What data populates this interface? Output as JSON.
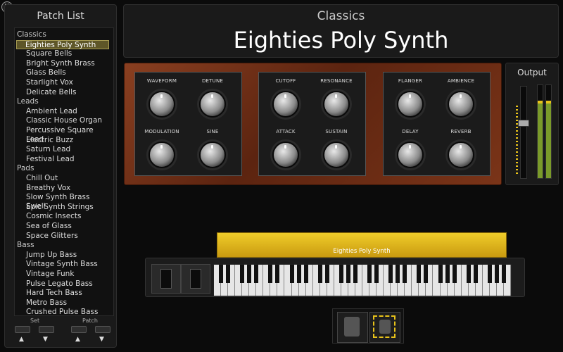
{
  "patch_list": {
    "title": "Patch List",
    "categories": [
      {
        "name": "Classics",
        "items": [
          "Eighties Poly Synth",
          "Square Bells",
          "Bright Synth Brass",
          "Glass Bells",
          "Starlight Vox",
          "Delicate Bells"
        ]
      },
      {
        "name": "Leads",
        "items": [
          "Ambient Lead",
          "Classic House Organ",
          "Percussive Square Lead",
          "Electric Buzz",
          "Saturn Lead",
          "Festival Lead"
        ]
      },
      {
        "name": "Pads",
        "items": [
          "Chill Out",
          "Breathy Vox",
          "Slow Synth Brass Swell",
          "Epic Synth Strings",
          "Cosmic Insects",
          "Sea of Glass",
          "Space Glitters"
        ]
      },
      {
        "name": "Bass",
        "items": [
          "Jump Up Bass",
          "Vintage Synth Bass",
          "Vintage Funk",
          "Pulse Legato Bass",
          "Hard Tech Bass",
          "Metro Bass",
          "Crushed Pulse Bass"
        ]
      }
    ],
    "selected": "Eighties Poly Synth",
    "set_label": "Set",
    "patch_label": "Patch",
    "up_glyph": "▲",
    "down_glyph": "▼"
  },
  "header": {
    "category": "Classics",
    "patch_name": "Eighties Poly Synth"
  },
  "knobs": {
    "group1": [
      "WAVEFORM",
      "DETUNE",
      "MODULATION",
      "SINE"
    ],
    "group2": [
      "CUTOFF",
      "RESONANCE",
      "ATTACK",
      "SUSTAIN"
    ],
    "group3": [
      "FLANGER",
      "AMBIENCE",
      "DELAY",
      "REVERB"
    ]
  },
  "output": {
    "title": "Output",
    "level_left": 0.82,
    "level_right": 0.82
  },
  "keyboard": {
    "label": "Eighties Poly Synth"
  },
  "close_glyph": "✕",
  "colors": {
    "accent_yellow": "#e8c21a",
    "wood": "#7a3418",
    "selection": "#5e5628"
  }
}
